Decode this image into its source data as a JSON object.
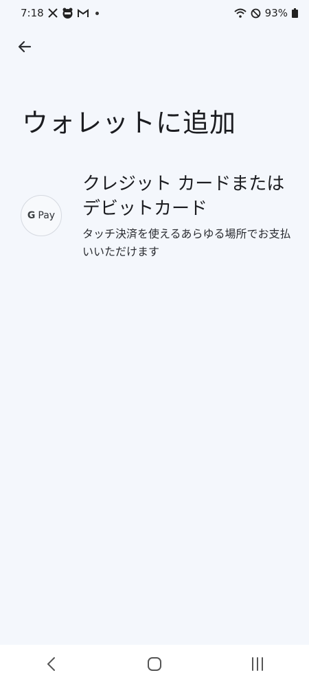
{
  "status_bar": {
    "time": "7:18",
    "battery_percent": "93%",
    "icons_left": [
      "x-icon",
      "app-badge-icon",
      "gmail-icon",
      "notification-dot"
    ],
    "icons_right": [
      "wifi-icon",
      "do-not-disturb-icon",
      "battery-icon"
    ]
  },
  "header": {
    "back_icon": "arrow-back-icon",
    "title": "ウォレットに追加"
  },
  "options": [
    {
      "logo_text": "Pay",
      "logo_letter": "G",
      "title": "クレジット カードまたはデビットカード",
      "description": "タッチ決済を使えるあらゆる場所でお支払いいただけます"
    }
  ],
  "nav_bar": {
    "buttons": [
      "back-nav-icon",
      "home-nav-icon",
      "recents-nav-icon"
    ]
  },
  "colors": {
    "background": "#f4f7fc",
    "nav_background": "#ffffff",
    "text": "#1b1c20"
  }
}
